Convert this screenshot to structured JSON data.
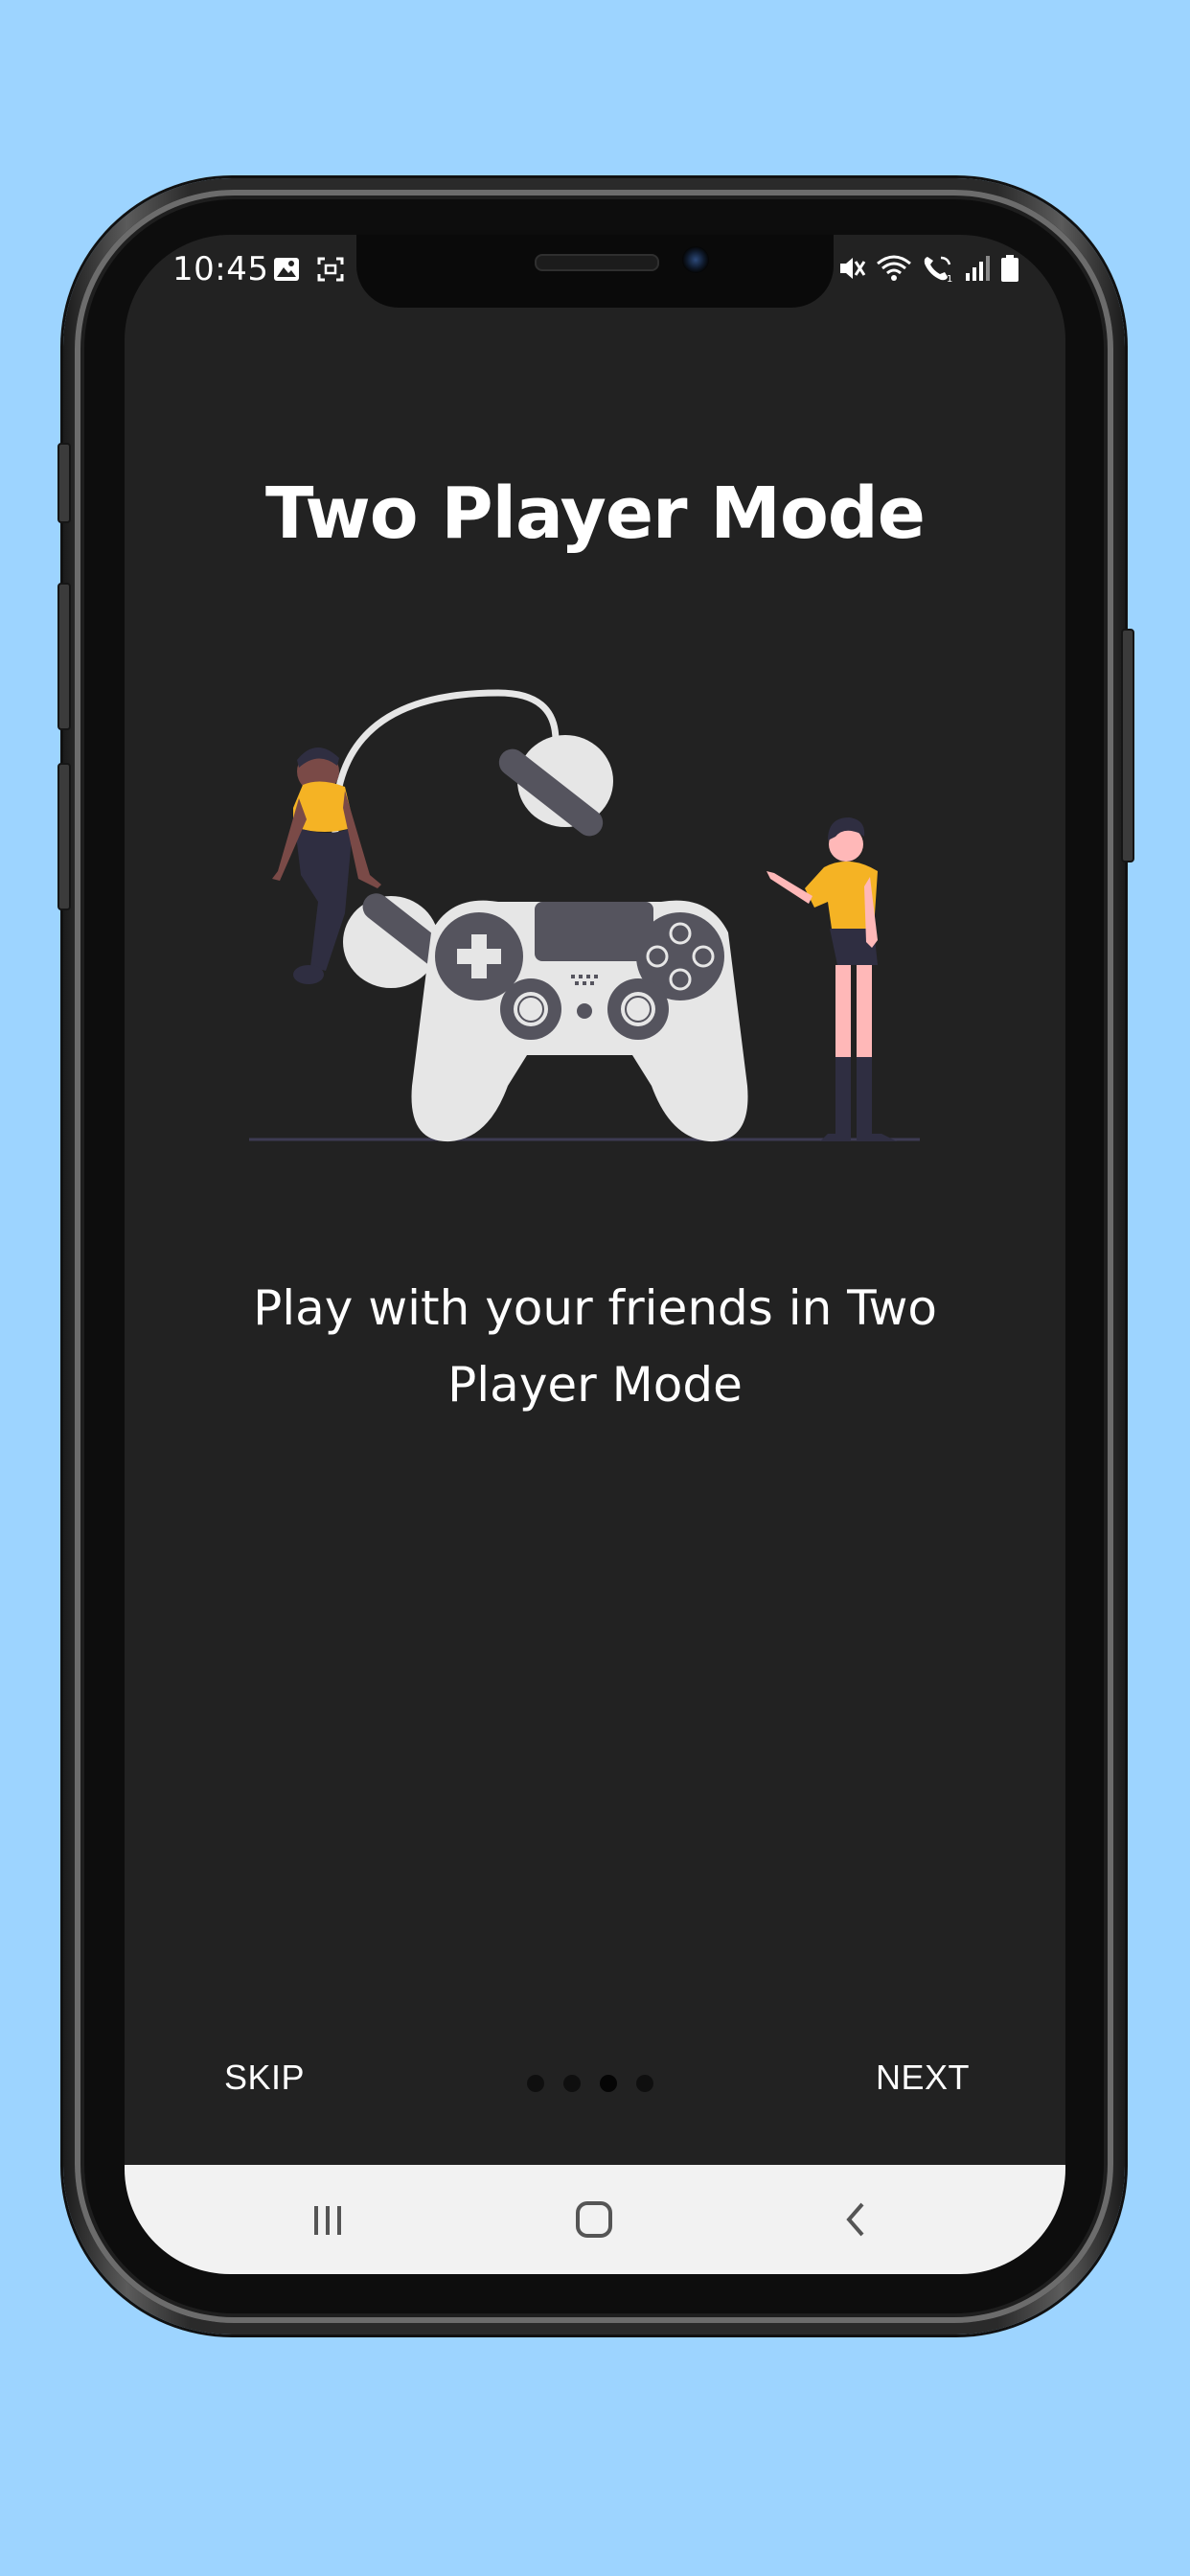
{
  "status_bar": {
    "time": "10:45",
    "left_icons": [
      "image-icon",
      "screenshot-icon",
      "notification-icon"
    ],
    "right_icons": [
      "mute-icon",
      "wifi-icon",
      "wifi-call-icon",
      "signal-icon",
      "battery-icon"
    ]
  },
  "onboarding": {
    "title": "Two Player Mode",
    "description": "Play with your friends in Two Player Mode",
    "illustration": "two-players-gamepad-illustration",
    "page_indicator": {
      "total": 4,
      "current": 3
    }
  },
  "controls": {
    "skip_label": "SKIP",
    "next_label": "NEXT"
  },
  "navigation_bar": {
    "buttons": [
      "recents-icon",
      "home-icon",
      "back-icon"
    ]
  },
  "colors": {
    "background": "#9dd4ff",
    "screen": "#222222",
    "accent_shirt": "#f5b324",
    "controller": "#e6e6e6",
    "controller_dark": "#55545e",
    "text": "#ffffff",
    "nav_bar": "#f2f2f2"
  }
}
